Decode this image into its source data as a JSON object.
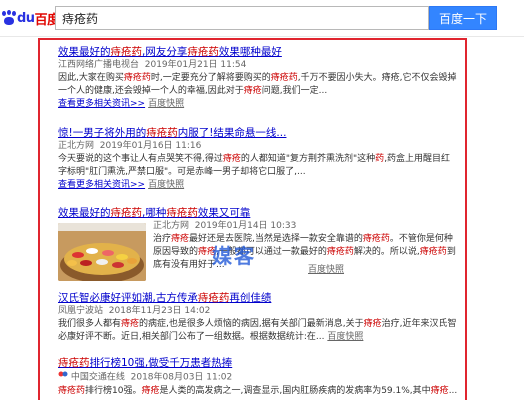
{
  "header": {
    "logo_text": "百度",
    "search_value": "痔疮药",
    "search_button": "百度一下"
  },
  "results": [
    {
      "title_parts": [
        "效果最好的",
        "痔疮药",
        ",网友分享",
        "痔疮药",
        "效果哪种最好"
      ],
      "source": "江西网络广播电视台",
      "date": "2019年01月21日 11:54",
      "abstract_parts": [
        "因此,大家在购买",
        "痔疮药",
        "时,一定要充分了解将要购买的",
        "痔疮药",
        ",千万不要因小失大。痔疮,它不仅会毁掉一个人的健康,还会毁掉一个人的幸福,因此对于",
        "痔疮",
        "问题,我们一定..."
      ],
      "more_link": "查看更多相关资讯>>",
      "snapshot": "百度快照"
    },
    {
      "title_parts": [
        "惊!一男子将外用的",
        "痔疮药",
        "内服了!结果命悬一线..."
      ],
      "source": "正北方网",
      "date": "2019年01月16日 11:16",
      "abstract_parts": [
        "今天要说的这个事让人有点哭笑不得,得过",
        "痔疮",
        "的人都知道\"复方荆芥熏洗剂\"这种",
        "药",
        ",药盒上用醒目红字标明\"肛门熏洗,严禁口服\"。可是赤峰一男子却将它口服了,..."
      ],
      "more_link": "查看更多相关资讯>>",
      "snapshot": "百度快照"
    },
    {
      "title_parts": [
        "效果最好的",
        "痔疮药",
        ",哪种",
        "痔疮药",
        "效果又可靠"
      ],
      "source": "正北方网",
      "date": "2019年01月14日 10:33",
      "abstract_parts": [
        "治疗",
        "痔疮",
        "最好还是去医院,当然是选择一款安全靠谱的",
        "痔疮药",
        "。不管你是何种原因导致的",
        "痔疮",
        ",一般都可以通过一款最好的",
        "痔疮药",
        "解决的。所以说,",
        "痔疮药",
        "到底有没有用好于..."
      ],
      "snapshot": "百度快照"
    },
    {
      "title_parts": [
        "汉氏智必康好评如潮,古方传承",
        "痔疮药",
        "再创佳绩"
      ],
      "source": "凤凰宁波站",
      "date": "2018年11月23日 14:02",
      "abstract_parts": [
        "我们很多人都有",
        "痔疮",
        "的病症,也是很多人烦恼的病因,据有关部门最新消息,关于",
        "痔疮",
        "治疗,近年来汉氏智必康好评不断。近日,相关部门公布了一组数据。根据数据统计:在..."
      ],
      "snapshot": "百度快照"
    },
    {
      "title_parts": [
        "痔疮药",
        "排行榜10强,做受千万患者热捧"
      ],
      "source": "中国交通在线",
      "date": "2018年08月03日 11:02",
      "abstract_parts": [
        "痔疮药",
        "排行榜10强。",
        "痔疮",
        "是人类的高发病之一,调查显示,国内肛肠疾病的发病率为59.1%,其中",
        "痔疮",
        "..."
      ]
    }
  ],
  "watermark": "媒客"
}
